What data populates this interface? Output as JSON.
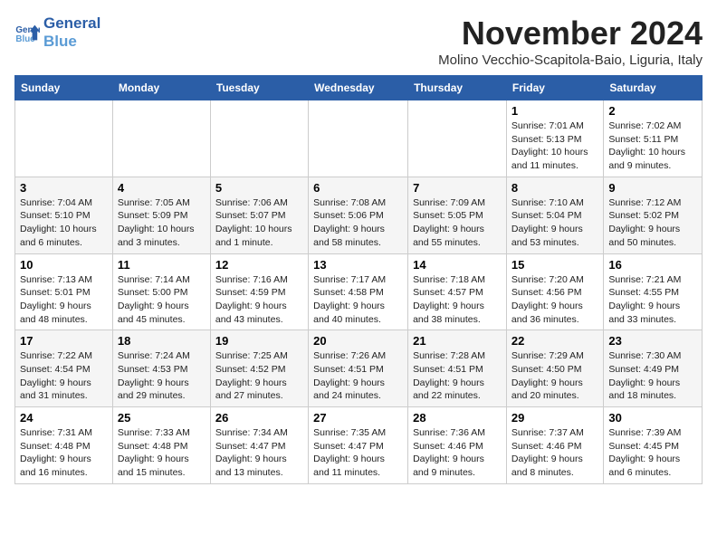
{
  "logo": {
    "line1": "General",
    "line2": "Blue"
  },
  "header": {
    "month_year": "November 2024",
    "location": "Molino Vecchio-Scapitola-Baio, Liguria, Italy"
  },
  "weekdays": [
    "Sunday",
    "Monday",
    "Tuesday",
    "Wednesday",
    "Thursday",
    "Friday",
    "Saturday"
  ],
  "weeks": [
    [
      {
        "day": "",
        "info": ""
      },
      {
        "day": "",
        "info": ""
      },
      {
        "day": "",
        "info": ""
      },
      {
        "day": "",
        "info": ""
      },
      {
        "day": "",
        "info": ""
      },
      {
        "day": "1",
        "info": "Sunrise: 7:01 AM\nSunset: 5:13 PM\nDaylight: 10 hours\nand 11 minutes."
      },
      {
        "day": "2",
        "info": "Sunrise: 7:02 AM\nSunset: 5:11 PM\nDaylight: 10 hours\nand 9 minutes."
      }
    ],
    [
      {
        "day": "3",
        "info": "Sunrise: 7:04 AM\nSunset: 5:10 PM\nDaylight: 10 hours\nand 6 minutes."
      },
      {
        "day": "4",
        "info": "Sunrise: 7:05 AM\nSunset: 5:09 PM\nDaylight: 10 hours\nand 3 minutes."
      },
      {
        "day": "5",
        "info": "Sunrise: 7:06 AM\nSunset: 5:07 PM\nDaylight: 10 hours\nand 1 minute."
      },
      {
        "day": "6",
        "info": "Sunrise: 7:08 AM\nSunset: 5:06 PM\nDaylight: 9 hours\nand 58 minutes."
      },
      {
        "day": "7",
        "info": "Sunrise: 7:09 AM\nSunset: 5:05 PM\nDaylight: 9 hours\nand 55 minutes."
      },
      {
        "day": "8",
        "info": "Sunrise: 7:10 AM\nSunset: 5:04 PM\nDaylight: 9 hours\nand 53 minutes."
      },
      {
        "day": "9",
        "info": "Sunrise: 7:12 AM\nSunset: 5:02 PM\nDaylight: 9 hours\nand 50 minutes."
      }
    ],
    [
      {
        "day": "10",
        "info": "Sunrise: 7:13 AM\nSunset: 5:01 PM\nDaylight: 9 hours\nand 48 minutes."
      },
      {
        "day": "11",
        "info": "Sunrise: 7:14 AM\nSunset: 5:00 PM\nDaylight: 9 hours\nand 45 minutes."
      },
      {
        "day": "12",
        "info": "Sunrise: 7:16 AM\nSunset: 4:59 PM\nDaylight: 9 hours\nand 43 minutes."
      },
      {
        "day": "13",
        "info": "Sunrise: 7:17 AM\nSunset: 4:58 PM\nDaylight: 9 hours\nand 40 minutes."
      },
      {
        "day": "14",
        "info": "Sunrise: 7:18 AM\nSunset: 4:57 PM\nDaylight: 9 hours\nand 38 minutes."
      },
      {
        "day": "15",
        "info": "Sunrise: 7:20 AM\nSunset: 4:56 PM\nDaylight: 9 hours\nand 36 minutes."
      },
      {
        "day": "16",
        "info": "Sunrise: 7:21 AM\nSunset: 4:55 PM\nDaylight: 9 hours\nand 33 minutes."
      }
    ],
    [
      {
        "day": "17",
        "info": "Sunrise: 7:22 AM\nSunset: 4:54 PM\nDaylight: 9 hours\nand 31 minutes."
      },
      {
        "day": "18",
        "info": "Sunrise: 7:24 AM\nSunset: 4:53 PM\nDaylight: 9 hours\nand 29 minutes."
      },
      {
        "day": "19",
        "info": "Sunrise: 7:25 AM\nSunset: 4:52 PM\nDaylight: 9 hours\nand 27 minutes."
      },
      {
        "day": "20",
        "info": "Sunrise: 7:26 AM\nSunset: 4:51 PM\nDaylight: 9 hours\nand 24 minutes."
      },
      {
        "day": "21",
        "info": "Sunrise: 7:28 AM\nSunset: 4:51 PM\nDaylight: 9 hours\nand 22 minutes."
      },
      {
        "day": "22",
        "info": "Sunrise: 7:29 AM\nSunset: 4:50 PM\nDaylight: 9 hours\nand 20 minutes."
      },
      {
        "day": "23",
        "info": "Sunrise: 7:30 AM\nSunset: 4:49 PM\nDaylight: 9 hours\nand 18 minutes."
      }
    ],
    [
      {
        "day": "24",
        "info": "Sunrise: 7:31 AM\nSunset: 4:48 PM\nDaylight: 9 hours\nand 16 minutes."
      },
      {
        "day": "25",
        "info": "Sunrise: 7:33 AM\nSunset: 4:48 PM\nDaylight: 9 hours\nand 15 minutes."
      },
      {
        "day": "26",
        "info": "Sunrise: 7:34 AM\nSunset: 4:47 PM\nDaylight: 9 hours\nand 13 minutes."
      },
      {
        "day": "27",
        "info": "Sunrise: 7:35 AM\nSunset: 4:47 PM\nDaylight: 9 hours\nand 11 minutes."
      },
      {
        "day": "28",
        "info": "Sunrise: 7:36 AM\nSunset: 4:46 PM\nDaylight: 9 hours\nand 9 minutes."
      },
      {
        "day": "29",
        "info": "Sunrise: 7:37 AM\nSunset: 4:46 PM\nDaylight: 9 hours\nand 8 minutes."
      },
      {
        "day": "30",
        "info": "Sunrise: 7:39 AM\nSunset: 4:45 PM\nDaylight: 9 hours\nand 6 minutes."
      }
    ]
  ]
}
